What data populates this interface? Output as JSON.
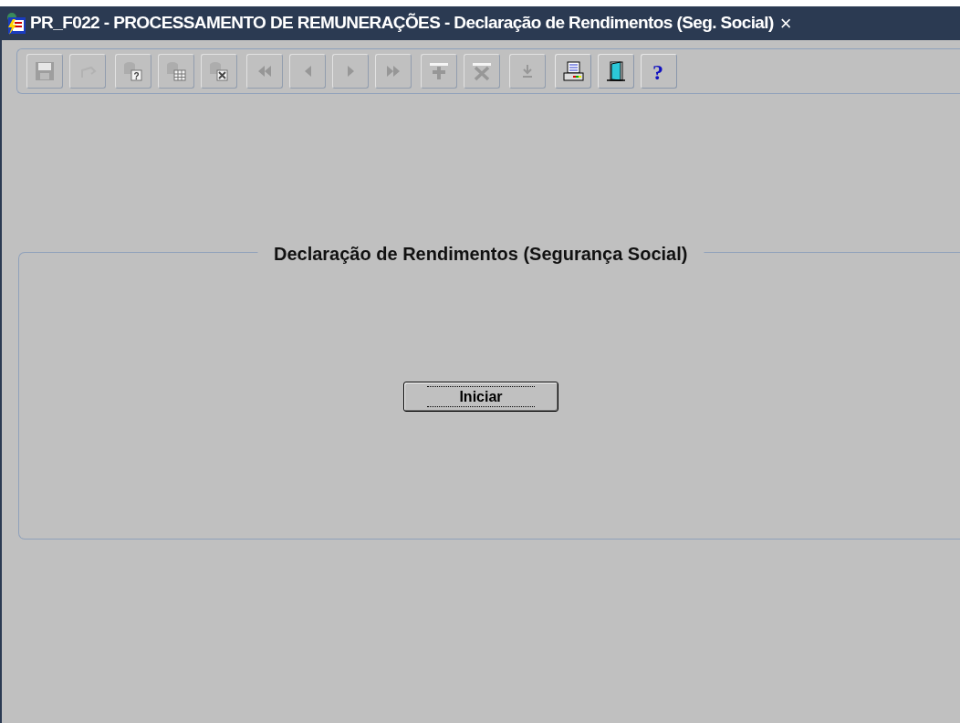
{
  "window": {
    "title": "PR_F022 - PROCESSAMENTO DE REMUNERAÇÕES - Declaração de Rendimentos (Seg. Social)",
    "close": "×"
  },
  "toolbar": [
    {
      "kind": "save",
      "disabled": true
    },
    {
      "kind": "undo",
      "disabled": true
    },
    {
      "kind": "query-enter",
      "disabled": true,
      "glyph": "?"
    },
    {
      "kind": "query-execute",
      "disabled": true
    },
    {
      "kind": "query-cancel",
      "disabled": true
    },
    {
      "kind": "first",
      "disabled": true
    },
    {
      "kind": "previous",
      "disabled": true
    },
    {
      "kind": "next",
      "disabled": true
    },
    {
      "kind": "last",
      "disabled": true
    },
    {
      "kind": "insert",
      "disabled": true
    },
    {
      "kind": "delete",
      "disabled": true
    },
    {
      "kind": "download",
      "disabled": true
    },
    {
      "kind": "print",
      "disabled": false
    },
    {
      "kind": "exit",
      "disabled": false
    },
    {
      "kind": "help",
      "disabled": false,
      "glyph": "?"
    }
  ],
  "frame": {
    "title": "Declaração de Rendimentos (Segurança Social)",
    "button": "Iniciar"
  }
}
